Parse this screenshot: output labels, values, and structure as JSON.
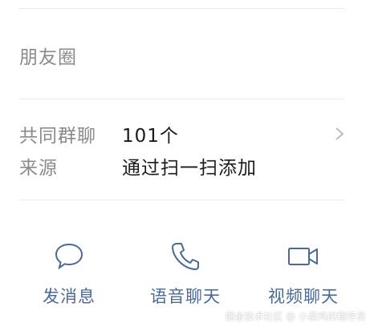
{
  "moments": {
    "label": "朋友圈"
  },
  "info_rows": [
    {
      "label": "共同群聊",
      "value": "101个"
    },
    {
      "label": "来源",
      "value": "通过扫一扫添加"
    }
  ],
  "actions": [
    {
      "label": "发消息",
      "icon": "chat-bubble-icon"
    },
    {
      "label": "语音聊天",
      "icon": "phone-icon"
    },
    {
      "label": "视频聊天",
      "icon": "video-camera-icon"
    }
  ],
  "watermark": "掘金技术社区 @ 小菜鸡的程序员",
  "colors": {
    "action_blue": "#4a6a95",
    "label_gray": "#8a8a8a",
    "value_dark": "#1a1a1a",
    "divider": "#ececec"
  }
}
